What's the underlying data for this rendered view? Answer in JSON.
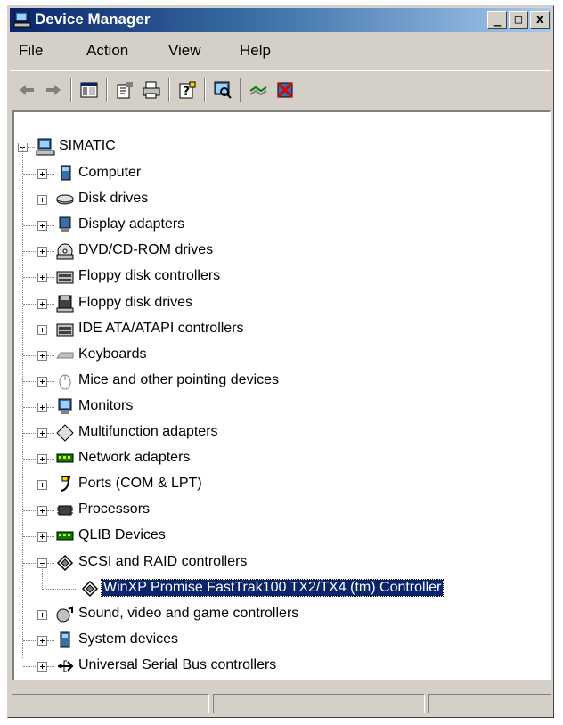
{
  "window": {
    "title": "Device Manager",
    "minimize": "_",
    "maximize": "□",
    "close": "x"
  },
  "menu": {
    "items": [
      "File",
      "Action",
      "View",
      "Help"
    ]
  },
  "toolbar": {
    "buttons": [
      "back-arrow-icon",
      "forward-arrow-icon",
      "show-hide-console-tree-icon",
      "properties-icon",
      "print-icon",
      "help-icon",
      "scan-hardware-icon",
      "update-driver-icon",
      "uninstall-icon"
    ]
  },
  "tree": {
    "root": "SIMATIC",
    "categories": [
      {
        "label": "Computer",
        "icon": "computer-icon"
      },
      {
        "label": "Disk drives",
        "icon": "disk-drive-icon"
      },
      {
        "label": "Display adapters",
        "icon": "display-adapter-icon"
      },
      {
        "label": "DVD/CD-ROM drives",
        "icon": "cdrom-icon"
      },
      {
        "label": "Floppy disk controllers",
        "icon": "floppy-controller-icon"
      },
      {
        "label": "Floppy disk drives",
        "icon": "floppy-drive-icon"
      },
      {
        "label": "IDE ATA/ATAPI controllers",
        "icon": "ide-controller-icon"
      },
      {
        "label": "Keyboards",
        "icon": "keyboard-icon"
      },
      {
        "label": "Mice and other pointing devices",
        "icon": "mouse-icon"
      },
      {
        "label": "Monitors",
        "icon": "monitor-icon"
      },
      {
        "label": "Multifunction adapters",
        "icon": "multifunction-icon"
      },
      {
        "label": "Network adapters",
        "icon": "network-adapter-icon"
      },
      {
        "label": "Ports (COM & LPT)",
        "icon": "port-icon"
      },
      {
        "label": "Processors",
        "icon": "processor-icon"
      },
      {
        "label": "QLIB Devices",
        "icon": "qlib-device-icon"
      },
      {
        "label": "SCSI and RAID controllers",
        "icon": "scsi-icon"
      },
      {
        "label": "WinXP Promise FastTrak100 TX2/TX4 (tm) Controller",
        "icon": "scsi-device-icon"
      },
      {
        "label": "Sound, video and game controllers",
        "icon": "sound-icon"
      },
      {
        "label": "System devices",
        "icon": "system-device-icon"
      },
      {
        "label": "Universal Serial Bus controllers",
        "icon": "usb-icon"
      }
    ]
  },
  "colors": {
    "title_start": "#0a246a",
    "title_end": "#a6caf0",
    "selection": "#0a246a",
    "chrome": "#d4d0c8"
  }
}
